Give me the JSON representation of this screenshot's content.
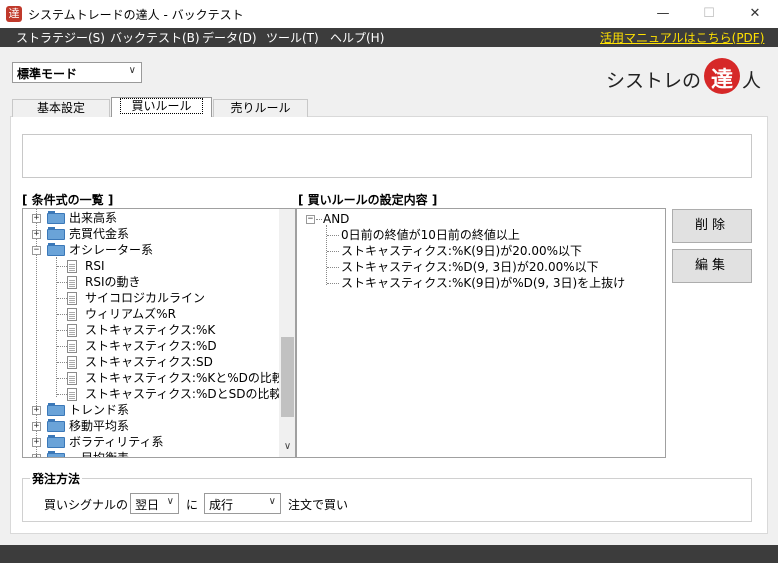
{
  "window": {
    "title": "システムトレードの達人 - バックテスト",
    "icon_char": "達",
    "minimize": "—",
    "maximize": "☐",
    "close": "✕"
  },
  "menu": {
    "items": [
      "ストラテジー(S)",
      "バックテスト(B)",
      "データ(D)",
      "ツール(T)",
      "ヘルプ(H)"
    ],
    "manual_link": "活用マニュアルはこちら(PDF)"
  },
  "mode_select": {
    "value": "標準モード"
  },
  "logo": {
    "text_left": "シストレの",
    "seal_char": "達",
    "text_right": "人"
  },
  "tabs": [
    "基本設定",
    "買いルール",
    "売りルール"
  ],
  "labels": {
    "conditions": "[ 条件式の一覧 ]",
    "rules": "[ 買いルールの設定内容 ]"
  },
  "conditions_tree": [
    {
      "label": "出来高系",
      "type": "folder",
      "expanded": false
    },
    {
      "label": "売買代金系",
      "type": "folder",
      "expanded": false
    },
    {
      "label": "オシレーター系",
      "type": "folder",
      "expanded": true
    },
    {
      "label": "RSI",
      "type": "item"
    },
    {
      "label": "RSIの動き",
      "type": "item"
    },
    {
      "label": "サイコロジカルライン",
      "type": "item"
    },
    {
      "label": "ウィリアムズ%R",
      "type": "item"
    },
    {
      "label": "ストキャスティクス:%K",
      "type": "item"
    },
    {
      "label": "ストキャスティクス:%D",
      "type": "item"
    },
    {
      "label": "ストキャスティクス:SD",
      "type": "item"
    },
    {
      "label": "ストキャスティクス:%Kと%Dの比較",
      "type": "item"
    },
    {
      "label": "ストキャスティクス:%DとSDの比較",
      "type": "item"
    },
    {
      "label": "トレンド系",
      "type": "folder",
      "expanded": false
    },
    {
      "label": "移動平均系",
      "type": "folder",
      "expanded": false
    },
    {
      "label": "ボラティリティ系",
      "type": "folder",
      "expanded": false
    },
    {
      "label": "一目均衡表",
      "type": "folder",
      "expanded": false
    }
  ],
  "rules_tree": {
    "root": "AND",
    "items": [
      "0日前の終値が10日前の終値以上",
      "ストキャスティクス:%K(9日)が20.00%以下",
      "ストキャスティクス:%D(9, 3日)が20.00%以下",
      "ストキャスティクス:%K(9日)が%D(9, 3日)を上抜け"
    ]
  },
  "buttons": {
    "delete": "削除",
    "edit": "編集"
  },
  "order": {
    "legend": "発注方法",
    "signal_label": "買いシグナルの",
    "day_value": "翌日",
    "ni": "に",
    "type_value": "成行",
    "suffix": "注文で買い"
  },
  "colors": {
    "menubar": "#3c3c3c",
    "manual_link": "#ffe100",
    "seal": "#d62828"
  }
}
